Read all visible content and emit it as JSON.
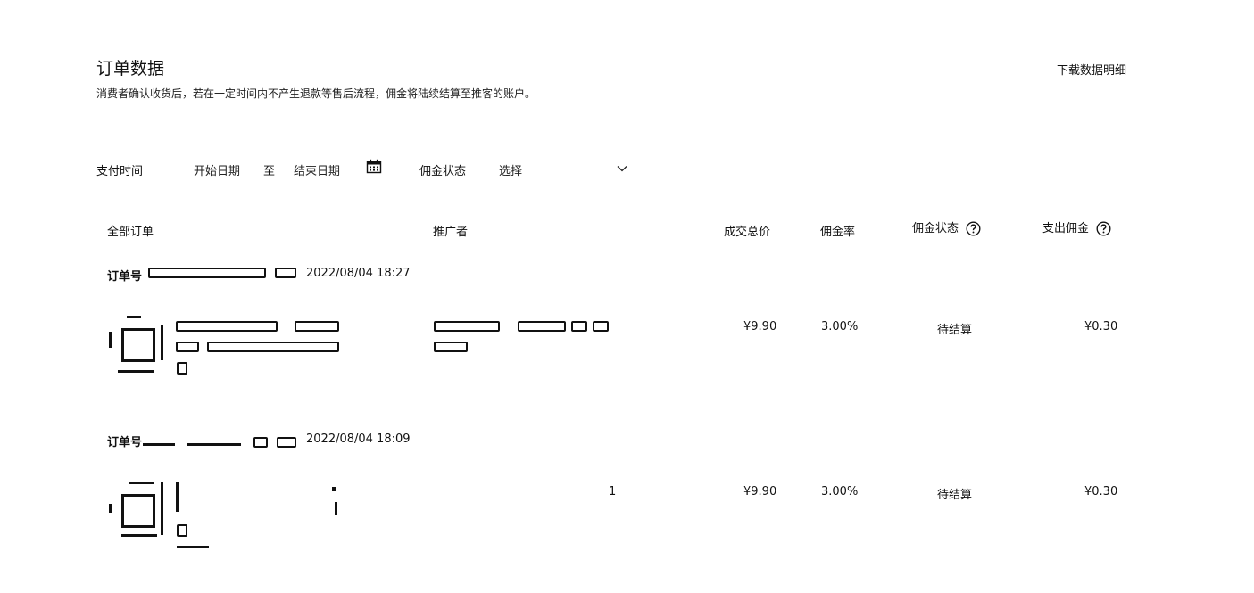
{
  "header": {
    "title": "订单数据",
    "download_label": "下载数据明细",
    "subtitle": "消费者确认收货后，若在一定时间内不产生退款等售后流程，佣金将陆续结算至推客的账户。"
  },
  "filters": {
    "pay_time_label": "支付时间",
    "start_placeholder": "开始日期",
    "range_separator": "至",
    "end_placeholder": "结束日期",
    "calendar_icon": "calendar-icon",
    "commission_status_label": "佣金状态",
    "status_select_placeholder": "选择",
    "select_icon": "chevron-down-icon"
  },
  "table": {
    "columns": {
      "all_orders": "全部订单",
      "promoter": "推广者",
      "total_price": "成交总价",
      "commission_rate": "佣金率",
      "commission_status": "佣金状态",
      "paid_commission": "支出佣金"
    },
    "help_icon": "help-circle-icon",
    "orders": [
      {
        "order_label": "订单号",
        "time": "2022/08/04 18:27",
        "price": "¥9.90",
        "rate": "3.00%",
        "status": "待结算",
        "commission": "¥0.30"
      },
      {
        "order_label": "订单号",
        "time": "2022/08/04 18:09",
        "promoter_fragment": "1",
        "price": "¥9.90",
        "rate": "3.00%",
        "status": "待结算",
        "commission": "¥0.30"
      }
    ]
  }
}
